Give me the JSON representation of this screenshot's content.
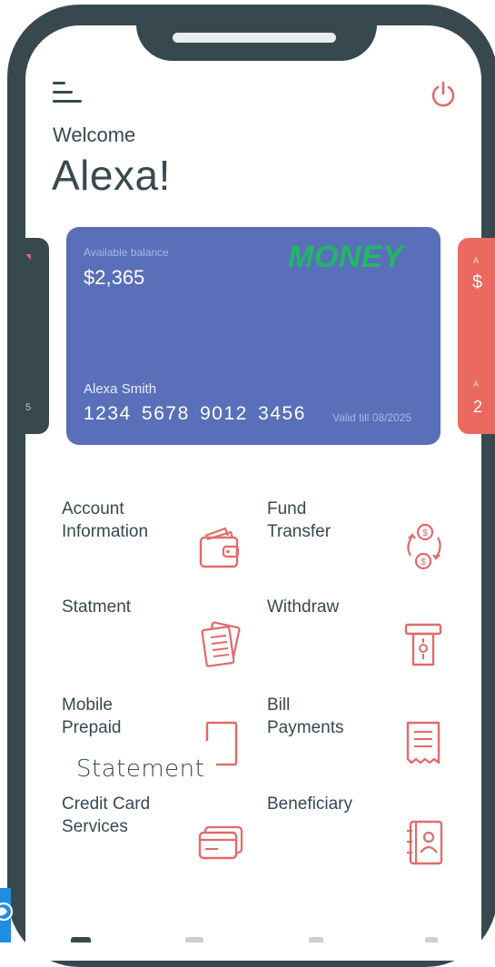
{
  "header": {
    "menu_icon": "menu-icon",
    "power_icon": "power-icon",
    "welcome": "Welcome",
    "name": "Alexa!"
  },
  "card": {
    "available_label": "Available balance",
    "balance": "$2,365",
    "brand": "MONEY",
    "holder": "Alexa Smith",
    "number": "1234 5678 9012 3456",
    "valid": "Valid till 08/2025",
    "color": "#5a6fb9",
    "brand_color": "#22b765"
  },
  "side_cards": {
    "left_number": "5",
    "right_label_top": "A",
    "right_amount": "$",
    "right_label_bottom": "A",
    "right_digit": "2",
    "right_color": "#ea6a5f"
  },
  "services": [
    {
      "label": "Account\nInformation",
      "icon": "wallet-icon"
    },
    {
      "label": "Fund\nTransfer",
      "icon": "money-transfer-icon"
    },
    {
      "label": "Statment",
      "icon": "statement-icon"
    },
    {
      "label": "Withdraw",
      "icon": "atm-withdraw-icon"
    },
    {
      "label": "Mobile\nPrepaid",
      "icon": "mobile-phone-icon"
    },
    {
      "label": "Bill\nPayments",
      "icon": "bill-receipt-icon"
    },
    {
      "label": "Credit Card\nServices",
      "icon": "credit-card-icon"
    },
    {
      "label": "Beneficiary",
      "icon": "contact-book-icon"
    }
  ],
  "overlay_label": "Statement",
  "accent_color": "#e36a6a",
  "dark_color": "#37494f"
}
